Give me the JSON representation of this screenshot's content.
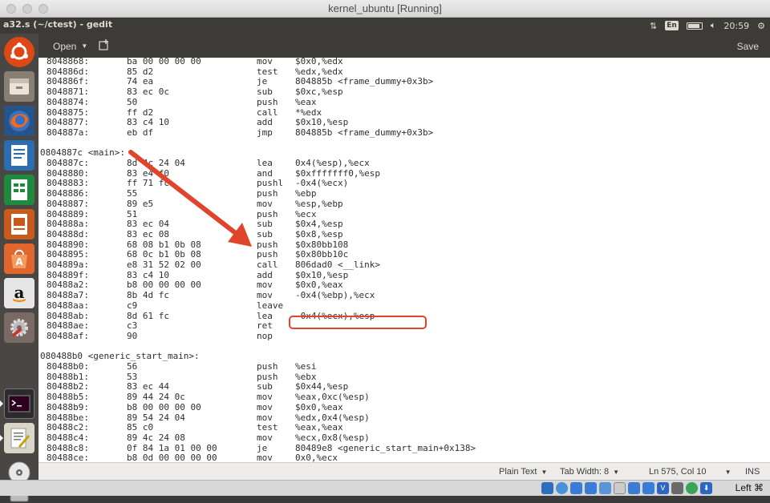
{
  "window": {
    "title": "kernel_ubuntu [Running]",
    "gedit_title": "a32.s (~/ctest) - gedit"
  },
  "panel": {
    "keyboard_layout": "En",
    "time": "20:59"
  },
  "header": {
    "open_label": "Open",
    "save_label": "Save"
  },
  "launcher": {
    "items": [
      {
        "name": "ubuntu-dash-icon",
        "color": "#dd4814"
      },
      {
        "name": "files-icon",
        "color": "#8a7f74"
      },
      {
        "name": "firefox-icon",
        "color": "#e66000"
      },
      {
        "name": "writer-icon",
        "color": "#2a6db0"
      },
      {
        "name": "calc-icon",
        "color": "#1f8a3e"
      },
      {
        "name": "impress-icon",
        "color": "#c85a1b"
      },
      {
        "name": "software-center-icon",
        "color": "#e0662e"
      },
      {
        "name": "amazon-icon",
        "color": "#dcdcdc"
      },
      {
        "name": "settings-icon",
        "color": "#a8472a"
      },
      {
        "name": "terminal-icon",
        "color": "#2b2b2b"
      },
      {
        "name": "text-editor-icon",
        "color": "#d9d5c8"
      },
      {
        "name": "dvd-icon",
        "color": "#bbbbbb"
      },
      {
        "name": "usb-drive-icon",
        "color": "#9a9a9a"
      }
    ]
  },
  "code": {
    "lines": [
      {
        "addr": "8048868:",
        "bytes": "ba 00 00 00 00",
        "mn": "mov",
        "ops": "$0x0,%edx"
      },
      {
        "addr": "804886d:",
        "bytes": "85 d2",
        "mn": "test",
        "ops": "%edx,%edx"
      },
      {
        "addr": "804886f:",
        "bytes": "74 ea",
        "mn": "je",
        "ops": "804885b <frame_dummy+0x3b>"
      },
      {
        "addr": "8048871:",
        "bytes": "83 ec 0c",
        "mn": "sub",
        "ops": "$0xc,%esp"
      },
      {
        "addr": "8048874:",
        "bytes": "50",
        "mn": "push",
        "ops": "%eax"
      },
      {
        "addr": "8048875:",
        "bytes": "ff d2",
        "mn": "call",
        "ops": "*%edx"
      },
      {
        "addr": "8048877:",
        "bytes": "83 c4 10",
        "mn": "add",
        "ops": "$0x10,%esp"
      },
      {
        "addr": "804887a:",
        "bytes": "eb df",
        "mn": "jmp",
        "ops": "804885b <frame_dummy+0x3b>"
      },
      {
        "addr": "",
        "bytes": "",
        "mn": "",
        "ops": ""
      },
      {
        "label": "0804887c <main>:"
      },
      {
        "addr": "804887c:",
        "bytes": "8d 4c 24 04",
        "mn": "lea",
        "ops": "0x4(%esp),%ecx"
      },
      {
        "addr": "8048880:",
        "bytes": "83 e4 f0",
        "mn": "and",
        "ops": "$0xfffffff0,%esp"
      },
      {
        "addr": "8048883:",
        "bytes": "ff 71 fc",
        "mn": "pushl",
        "ops": "-0x4(%ecx)"
      },
      {
        "addr": "8048886:",
        "bytes": "55",
        "mn": "push",
        "ops": "%ebp"
      },
      {
        "addr": "8048887:",
        "bytes": "89 e5",
        "mn": "mov",
        "ops": "%esp,%ebp"
      },
      {
        "addr": "8048889:",
        "bytes": "51",
        "mn": "push",
        "ops": "%ecx"
      },
      {
        "addr": "804888a:",
        "bytes": "83 ec 04",
        "mn": "sub",
        "ops": "$0x4,%esp"
      },
      {
        "addr": "804888d:",
        "bytes": "83 ec 08",
        "mn": "sub",
        "ops": "$0x8,%esp"
      },
      {
        "addr": "8048890:",
        "bytes": "68 08 b1 0b 08",
        "mn": "push",
        "ops": "$0x80bb108"
      },
      {
        "addr": "8048895:",
        "bytes": "68 0c b1 0b 08",
        "mn": "push",
        "ops": "$0x80bb10c"
      },
      {
        "addr": "804889a:",
        "bytes": "e8 31 52 02 00",
        "mn": "call",
        "ops": "806dad0 <__link>"
      },
      {
        "addr": "804889f:",
        "bytes": "83 c4 10",
        "mn": "add",
        "ops": "$0x10,%esp"
      },
      {
        "addr": "80488a2:",
        "bytes": "b8 00 00 00 00",
        "mn": "mov",
        "ops": "$0x0,%eax"
      },
      {
        "addr": "80488a7:",
        "bytes": "8b 4d fc",
        "mn": "mov",
        "ops": "-0x4(%ebp),%ecx"
      },
      {
        "addr": "80488aa:",
        "bytes": "c9",
        "mn": "leave",
        "ops": ""
      },
      {
        "addr": "80488ab:",
        "bytes": "8d 61 fc",
        "mn": "lea",
        "ops": "-0x4(%ecx),%esp"
      },
      {
        "addr": "80488ae:",
        "bytes": "c3",
        "mn": "ret",
        "ops": ""
      },
      {
        "addr": "80488af:",
        "bytes": "90",
        "mn": "nop",
        "ops": ""
      },
      {
        "addr": "",
        "bytes": "",
        "mn": "",
        "ops": ""
      },
      {
        "label": "080488b0 <generic_start_main>:"
      },
      {
        "addr": "80488b0:",
        "bytes": "56",
        "mn": "push",
        "ops": "%esi"
      },
      {
        "addr": "80488b1:",
        "bytes": "53",
        "mn": "push",
        "ops": "%ebx"
      },
      {
        "addr": "80488b2:",
        "bytes": "83 ec 44",
        "mn": "sub",
        "ops": "$0x44,%esp"
      },
      {
        "addr": "80488b5:",
        "bytes": "89 44 24 0c",
        "mn": "mov",
        "ops": "%eax,0xc(%esp)"
      },
      {
        "addr": "80488b9:",
        "bytes": "b8 00 00 00 00",
        "mn": "mov",
        "ops": "$0x0,%eax"
      },
      {
        "addr": "80488be:",
        "bytes": "89 54 24 04",
        "mn": "mov",
        "ops": "%edx,0x4(%esp)"
      },
      {
        "addr": "80488c2:",
        "bytes": "85 c0",
        "mn": "test",
        "ops": "%eax,%eax"
      },
      {
        "addr": "80488c4:",
        "bytes": "89 4c 24 08",
        "mn": "mov",
        "ops": "%ecx,0x8(%esp)"
      },
      {
        "addr": "80488c8:",
        "bytes": "0f 84 1a 01 00 00",
        "mn": "je",
        "ops": "80489e8 <generic_start_main+0x138>"
      },
      {
        "addr": "80488ce:",
        "bytes": "b8 0d 00 00 00 00",
        "mn": "mov",
        "ops": "0x0,%ecx"
      }
    ]
  },
  "status": {
    "syntax": "Plain Text",
    "tab_width": "Tab Width: 8",
    "position": "Ln 575, Col 10",
    "mode": "INS"
  },
  "vbox": {
    "host_key": "Left ⌘"
  },
  "colors": {
    "annotation": "#e0452b"
  }
}
